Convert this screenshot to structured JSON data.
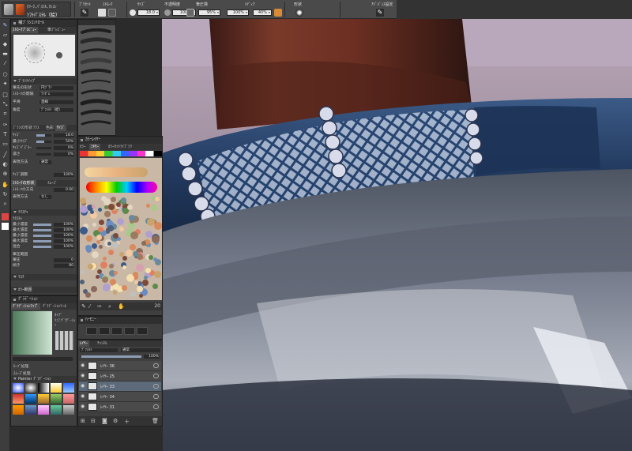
{
  "tool_badge": {
    "line1": "ﾀﾘｰｸ､ﾊﾟｽﾃﾙ､ｸﾚﾖﾝ",
    "line2": "ｿﾌﾄﾊﾟｽﾃﾙ（絵）"
  },
  "options_bar": {
    "labels": {
      "preset": "ﾌﾟﾘｾｯﾄ",
      "stroke": "ｽﾄﾛｰｸ",
      "size": "ｻｲｽﾞ",
      "opacity": "不透明度",
      "pen_pressure": "筆圧検",
      "media": "ﾒﾃﾞｨｱ",
      "shape": "形状",
      "advanced": "ｱﾄﾞﾊﾞﾝｽ設定"
    },
    "size_value": "18.0",
    "opacity_value": "100%",
    "pressure_value": "95%",
    "media_a_value": "100%",
    "media_b_value": "40%"
  },
  "brush_panel": {
    "title": "補ﾌﾞﾗｼｺﾝﾄﾛｰﾙ",
    "tabs": [
      "ｽﾄﾛｰｸﾌﾟﾚﾋﾞｭｰ",
      "筆ﾌﾟﾚﾋﾞｭｰ"
    ],
    "sub_title": "ﾌﾞﾗｼﾃｲｯﾌﾟ",
    "props": [
      {
        "label": "筆先の形状",
        "value": "円ﾌﾞﾗｼ"
      },
      {
        "label": "ｽﾄﾛｰｸの間隔",
        "value": "ﾗﾝﾀﾞﾑ"
      },
      {
        "label": "平滑",
        "value": "直線"
      },
      {
        "label": "角度",
        "value": "ﾃﾞﾌｫﾙﾄ（絵）"
      }
    ],
    "section_tabs": [
      "ﾌﾞﾗｼの形状",
      "ﾃｸｽ",
      "色彩",
      "ｻｲｽﾞ"
    ],
    "sliders": [
      {
        "label": "ｻｲｽﾞ",
        "value": "18.0",
        "fill": 0.6
      },
      {
        "label": "最小ｻｲｽﾞ",
        "value": "50%",
        "fill": 0.5
      },
      {
        "label": "ｻｲｽﾞﾊﾟｽﾞﾙｰ",
        "value": "0%",
        "fill": 0.0
      },
      {
        "label": "濃さ",
        "value": "0%",
        "fill": 0.0
      }
    ],
    "mode_label": "表現方法",
    "mode_value": "通常",
    "dir_label": "ｻｲｽﾞ調整",
    "dir_value": "100%",
    "stroke_shape_tabs": [
      "ｽﾄﾛｰｸの形状",
      "ｽﾑｰｽﾞ"
    ],
    "stroke_rows": [
      {
        "label": "ｽﾄﾛｰｸの方向",
        "value": "0.00"
      },
      {
        "label": "表現方法",
        "value": "なし"
      }
    ],
    "texture_title": "ﾃｸｽﾁｬ",
    "texture_rows": [
      {
        "label": "ﾃｸｽﾁｬ",
        "value": ""
      },
      {
        "label": "最小濃度",
        "value": "100%"
      },
      {
        "label": "最大濃度",
        "value": "100%"
      },
      {
        "label": "最小濃度",
        "value": "100%"
      },
      {
        "label": "最大濃度",
        "value": "100%"
      },
      {
        "label": "混合",
        "value": "100%"
      }
    ],
    "extra_rows": [
      {
        "label": "筆圧範囲",
        "value": ""
      },
      {
        "label": "筆圧",
        "value": "0"
      },
      {
        "label": "傾き",
        "value": "80"
      }
    ],
    "mask_title": "ﾏｽｸ",
    "color_mode_title": "ｶﾗｰ範囲"
  },
  "gradient_panel": {
    "title": "ｸﾞﾗﾃﾞｰｼｮﾝ",
    "tabs": [
      "ｸﾞﾗﾃﾞｰｼｮﾝﾏｯﾌﾟ",
      "ｸﾞﾗﾃﾞｰｼｮﾝﾂｰﾙ"
    ],
    "type_label": "ﾀｲﾌﾟ",
    "type_value": "ﾘﾆｱ ｸﾞﾗﾃﾞｰｼｮﾝ",
    "checkbox1": "ﾙｰﾌﾟ処理",
    "checkbox2": "ｽﾑｰｽﾞ処理",
    "preset_title": "Painter ｸﾞﾗﾃﾞｰｼｮﾝ"
  },
  "brush_sets": {
    "title": "",
    "strokes": 10
  },
  "color_panel": {
    "title": "ｶﾗｰﾚｲﾔｰ",
    "tabs": [
      "ｶﾗｰ",
      "ﾐｷｻｰ",
      "ｶﾗｰｾｯﾄﾗｲﾌﾞﾗﾘ"
    ],
    "size_value": "20"
  },
  "harmony_panel": {
    "title": "ﾊｰﾓﾆｰ"
  },
  "layers_panel": {
    "title": "ﾚｲﾔｰ",
    "tabs": [
      "ﾚｲﾔｰ",
      "ﾁｬﾝﾈﾙ"
    ],
    "blend": "ﾃﾞﾌｫﾙﾄ",
    "composite": "通常",
    "opacity": "100%",
    "layers": [
      {
        "name": "ﾚｲﾔｰ 36",
        "selected": false
      },
      {
        "name": "ﾚｲﾔｰ 25",
        "selected": false
      },
      {
        "name": "ﾚｲﾔｰ 33",
        "selected": true
      },
      {
        "name": "ﾚｲﾔｰ 34",
        "selected": false
      },
      {
        "name": "ﾚｲﾔｰ 31",
        "selected": false
      }
    ]
  }
}
